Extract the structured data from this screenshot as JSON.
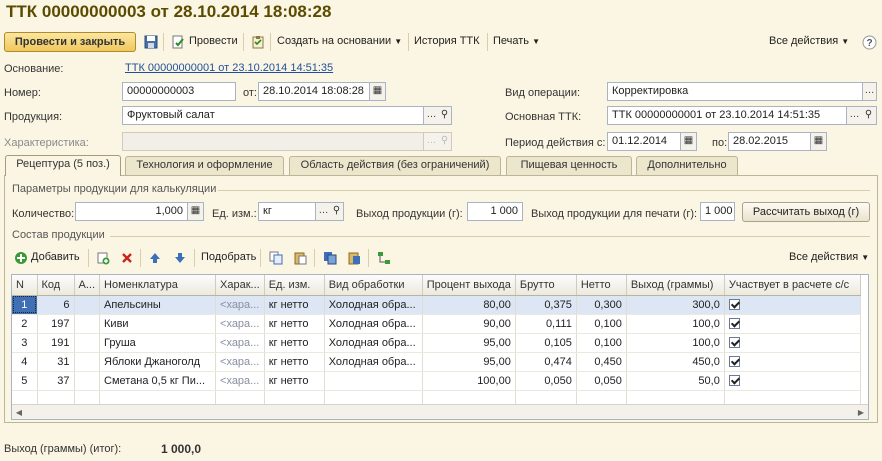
{
  "title": "ТТК 00000000003 от 28.10.2014 18:08:28",
  "toolbar": {
    "post_close": "Провести и закрыть",
    "post": "Провести",
    "create_based": "Создать на основании",
    "history": "История ТТК",
    "print": "Печать",
    "all_actions": "Все действия"
  },
  "header": {
    "basis_label": "Основание:",
    "basis_link": "ТТК 00000000001 от 23.10.2014 14:51:35",
    "number_label": "Номер:",
    "number_value": "00000000003",
    "from_label": "от:",
    "date_value": "28.10.2014 18:08:28",
    "operation_label": "Вид операции:",
    "operation_value": "Корректировка",
    "product_label": "Продукция:",
    "product_value": "Фруктовый салат",
    "main_ttk_label": "Основная ТТК:",
    "main_ttk_value": "ТТК 00000000001 от 23.10.2014 14:51:35",
    "characteristic_label": "Характеристика:",
    "characteristic_value": "",
    "period_label": "Период действия с:",
    "period_from": "01.12.2014",
    "period_to_label": "по:",
    "period_to": "28.02.2015"
  },
  "tabs": [
    {
      "label": "Рецептура (5 поз.)",
      "active": true
    },
    {
      "label": "Технология и оформление",
      "active": false
    },
    {
      "label": "Область действия (без ограничений)",
      "active": false
    },
    {
      "label": "Пищевая ценность",
      "active": false
    },
    {
      "label": "Дополнительно",
      "active": false
    }
  ],
  "params": {
    "group_title": "Параметры продукции для калькуляции",
    "qty_label": "Количество:",
    "qty_value": "1,000",
    "unit_label": "Ед. изм.:",
    "unit_value": "кг",
    "yield_label": "Выход продукции (г):",
    "yield_value": "1 000",
    "yield_print_label": "Выход продукции для печати (г):",
    "yield_print_value": "1 000",
    "calc_button": "Рассчитать выход (г)"
  },
  "composition": {
    "group_title": "Состав продукции",
    "add_label": "Добавить",
    "pick_label": "Подобрать",
    "all_actions": "Все действия"
  },
  "table": {
    "columns": [
      "N",
      "Код",
      "А...",
      "Номенклатура",
      "Харак...",
      "Ед. изм.",
      "Вид обработки",
      "Процент выхода",
      "Брутто",
      "Нетто",
      "Выход (граммы)",
      "Участвует в расчете с/с"
    ],
    "rows": [
      {
        "n": "1",
        "code": "6",
        "a": "",
        "name": "Апельсины",
        "char": "<хара...",
        "unit": "кг нетто",
        "proc": "Холодная обра...",
        "pct": "80,00",
        "gross": "0,375",
        "net": "0,300",
        "out": "300,0",
        "checked": true
      },
      {
        "n": "2",
        "code": "197",
        "a": "",
        "name": "Киви",
        "char": "<хара...",
        "unit": "кг нетто",
        "proc": "Холодная обра...",
        "pct": "90,00",
        "gross": "0,111",
        "net": "0,100",
        "out": "100,0",
        "checked": true
      },
      {
        "n": "3",
        "code": "191",
        "a": "",
        "name": "Груша",
        "char": "<хара...",
        "unit": "кг нетто",
        "proc": "Холодная обра...",
        "pct": "95,00",
        "gross": "0,105",
        "net": "0,100",
        "out": "100,0",
        "checked": true
      },
      {
        "n": "4",
        "code": "31",
        "a": "",
        "name": "Яблоки Джаноголд",
        "char": "<хара...",
        "unit": "кг нетто",
        "proc": "Холодная обра...",
        "pct": "95,00",
        "gross": "0,474",
        "net": "0,450",
        "out": "450,0",
        "checked": true
      },
      {
        "n": "5",
        "code": "37",
        "a": "",
        "name": "Сметана 0,5 кг  Пи...",
        "char": "<хара...",
        "unit": "кг нетто",
        "proc": "",
        "pct": "100,00",
        "gross": "0,050",
        "net": "0,050",
        "out": "50,0",
        "checked": true
      }
    ]
  },
  "footer": {
    "total_label": "Выход (граммы) (итог):",
    "total_value": "1 000,0"
  }
}
